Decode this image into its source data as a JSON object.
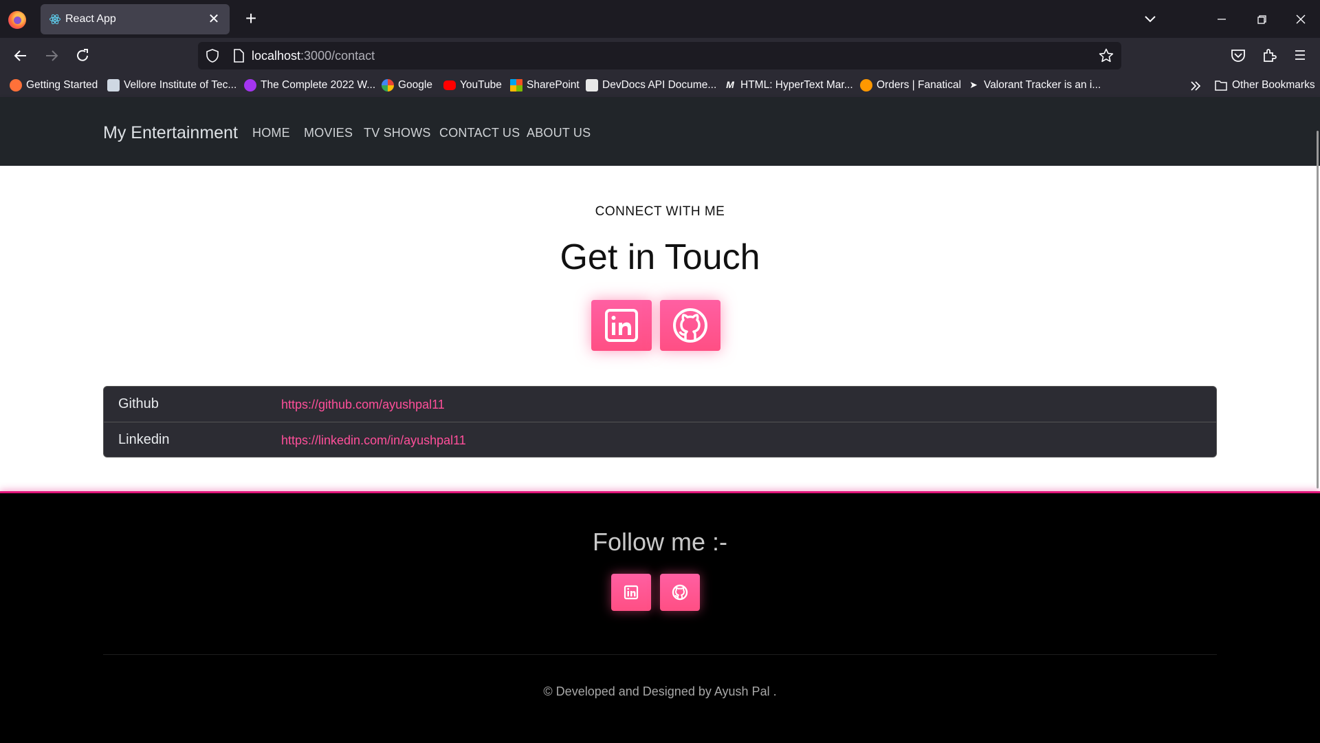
{
  "browser": {
    "tab_title": "React App",
    "url_host": "localhost",
    "url_path": ":3000/contact",
    "bookmarks": [
      {
        "label": "Getting Started",
        "color": "#ff7139"
      },
      {
        "label": "Vellore Institute of Tec...",
        "color": "#cfd8e3"
      },
      {
        "label": "The Complete 2022 W...",
        "color": "#a435f0"
      },
      {
        "label": "Google",
        "color": "#4285f4"
      },
      {
        "label": "YouTube",
        "color": "#ff0000"
      },
      {
        "label": "SharePoint",
        "color": "#0078d4"
      },
      {
        "label": "DevDocs API Docume...",
        "color": "#e8e8e8"
      },
      {
        "label": "HTML: HyperText Mar...",
        "color": "#ffffff"
      },
      {
        "label": "Orders | Fanatical",
        "color": "#ff9800"
      },
      {
        "label": "Valorant Tracker is an i...",
        "color": "#ffffff"
      }
    ],
    "other_bookmarks": "Other Bookmarks"
  },
  "site": {
    "brand": "My Entertainment",
    "nav": [
      "HOME",
      "MOVIES",
      "TV SHOWS",
      "CONTACT US",
      "ABOUT US"
    ]
  },
  "contact": {
    "eyebrow": "CONNECT WITH ME",
    "title": "Get in Touch",
    "rows": [
      {
        "label": "Github",
        "link": "https://github.com/ayushpal11"
      },
      {
        "label": "Linkedin",
        "link": "https://linkedin.com/in/ayushpal11"
      }
    ]
  },
  "footer": {
    "follow": "Follow me :-",
    "copyright": "© Developed and Designed by Ayush Pal ."
  },
  "colors": {
    "accent": "#ff4f9a",
    "navbar": "#212529",
    "footer_border": "#e0157a"
  }
}
